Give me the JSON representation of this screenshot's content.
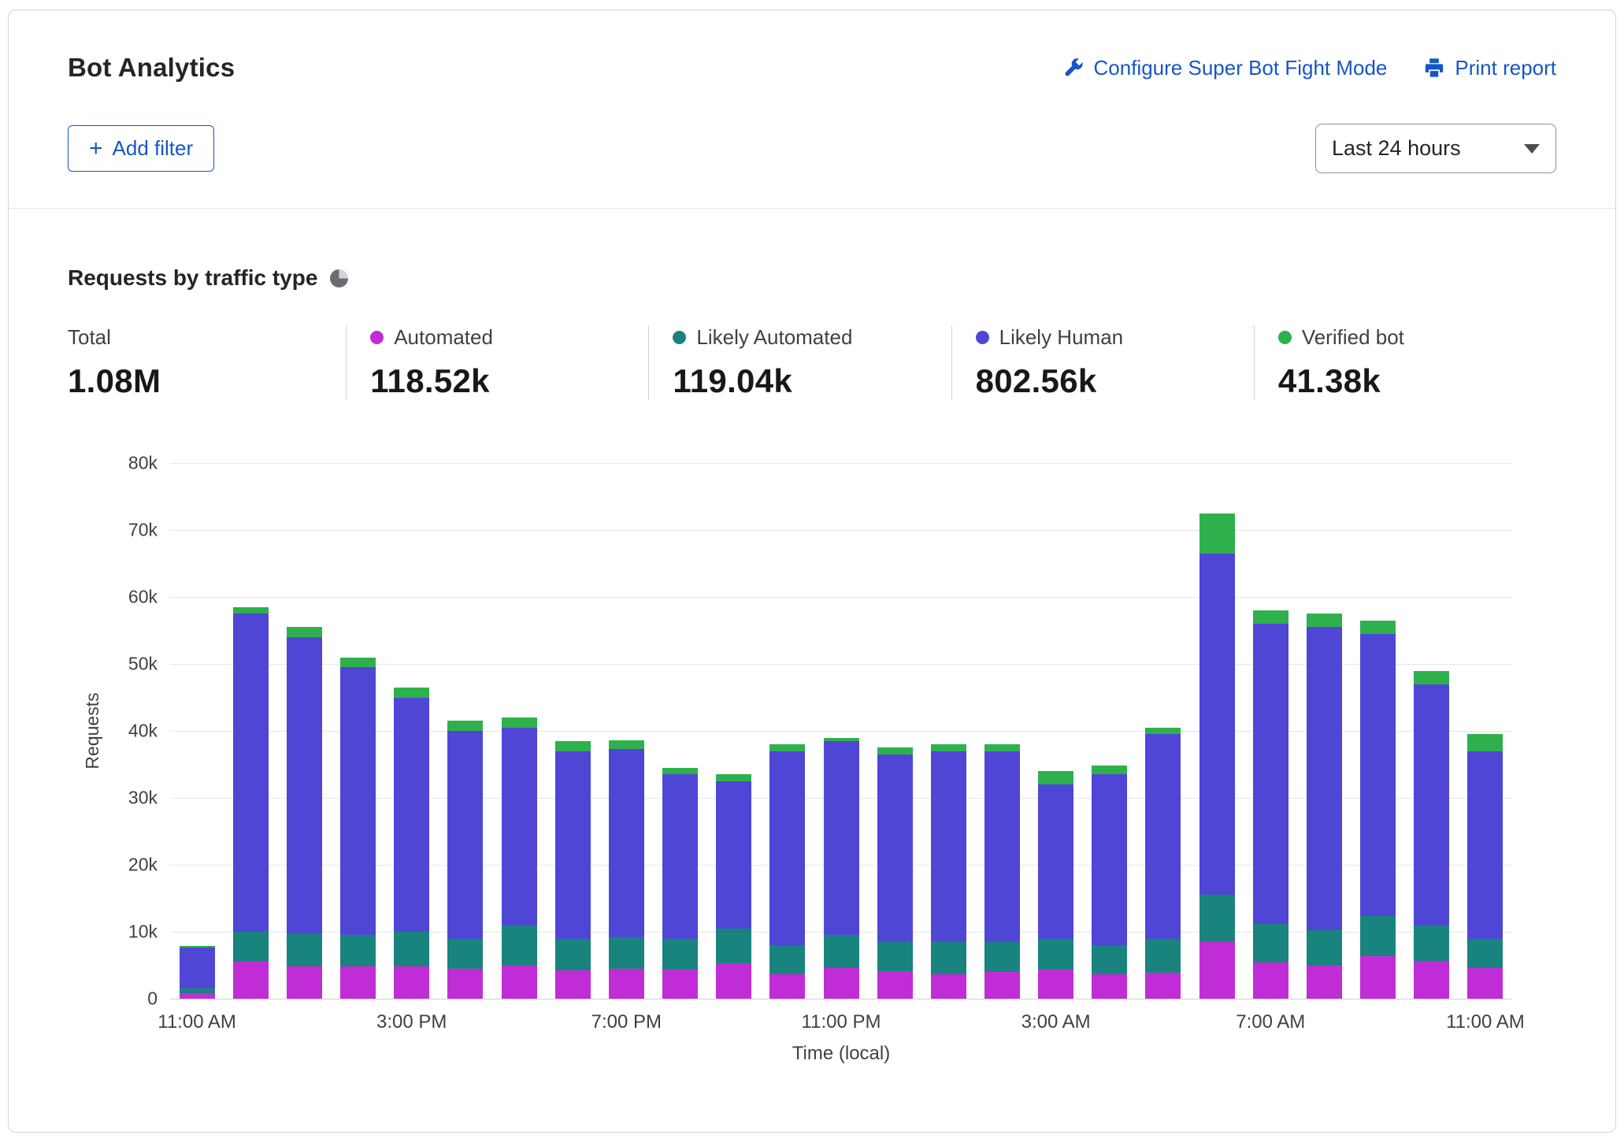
{
  "header": {
    "title": "Bot Analytics",
    "configure_link": "Configure Super Bot Fight Mode",
    "print_link": "Print report",
    "add_filter_plus": "+",
    "add_filter_label": "Add filter",
    "time_range_value": "Last 24 hours"
  },
  "section": {
    "title": "Requests by traffic type"
  },
  "stats": {
    "items": [
      {
        "label": "Total",
        "value": "1.08M"
      },
      {
        "label": "Automated",
        "value": "118.52k",
        "color": "#c02dd6"
      },
      {
        "label": "Likely Automated",
        "value": "119.04k",
        "color": "#19837e"
      },
      {
        "label": "Likely Human",
        "value": "802.56k",
        "color": "#4f46d6"
      },
      {
        "label": "Verified bot",
        "value": "41.38k",
        "color": "#2eb14c"
      }
    ]
  },
  "colors": {
    "link_blue": "#1656c9",
    "automated": "#c02dd6",
    "likely_automated": "#19837e",
    "likely_human": "#4f46d6",
    "verified_bot": "#2eb14c"
  },
  "chart_data": {
    "type": "bar",
    "stacked": true,
    "title": "Requests by traffic type",
    "xlabel": "Time (local)",
    "ylabel": "Requests",
    "ylim": [
      0,
      80000
    ],
    "grid": true,
    "y_ticks": [
      {
        "value": 0,
        "label": "0"
      },
      {
        "value": 10000,
        "label": "10k"
      },
      {
        "value": 20000,
        "label": "20k"
      },
      {
        "value": 30000,
        "label": "30k"
      },
      {
        "value": 40000,
        "label": "40k"
      },
      {
        "value": 50000,
        "label": "50k"
      },
      {
        "value": 60000,
        "label": "60k"
      },
      {
        "value": 70000,
        "label": "70k"
      },
      {
        "value": 80000,
        "label": "80k"
      }
    ],
    "x_tick_labels": [
      {
        "index": 0,
        "label": "11:00 AM"
      },
      {
        "index": 4,
        "label": "3:00 PM"
      },
      {
        "index": 8,
        "label": "7:00 PM"
      },
      {
        "index": 12,
        "label": "11:00 PM"
      },
      {
        "index": 16,
        "label": "3:00 AM"
      },
      {
        "index": 20,
        "label": "7:00 AM"
      },
      {
        "index": 24,
        "label": "11:00 AM"
      }
    ],
    "series": [
      {
        "name": "Automated",
        "color": "#c02dd6",
        "values": [
          800,
          5500,
          4800,
          4800,
          4800,
          4500,
          5000,
          4200,
          4500,
          4300,
          5300,
          3600,
          4600,
          4100,
          3600,
          4000,
          4400,
          3700,
          3900,
          8500,
          5400,
          5000,
          6400,
          5600,
          4600
        ]
      },
      {
        "name": "Likely Automated",
        "color": "#19837e",
        "values": [
          700,
          4500,
          5000,
          4700,
          5200,
          4500,
          6000,
          4800,
          4700,
          4700,
          5200,
          4400,
          4900,
          4400,
          4900,
          4500,
          4600,
          4300,
          5100,
          7000,
          5800,
          5200,
          6000,
          5400,
          4400
        ]
      },
      {
        "name": "Likely Human",
        "color": "#4f46d6",
        "values": [
          6100,
          47500,
          44200,
          40000,
          35000,
          31000,
          29500,
          28000,
          28100,
          24500,
          22000,
          29000,
          29000,
          28000,
          28500,
          28500,
          23000,
          25500,
          30500,
          51000,
          44800,
          45300,
          42100,
          36000,
          28000
        ]
      },
      {
        "name": "Verified bot",
        "color": "#2eb14c",
        "values": [
          300,
          1000,
          1500,
          1500,
          1500,
          1500,
          1500,
          1500,
          1300,
          1000,
          1000,
          1000,
          500,
          1000,
          1000,
          1000,
          2000,
          1300,
          1000,
          6000,
          2000,
          2000,
          2000,
          2000,
          2500
        ]
      }
    ]
  }
}
